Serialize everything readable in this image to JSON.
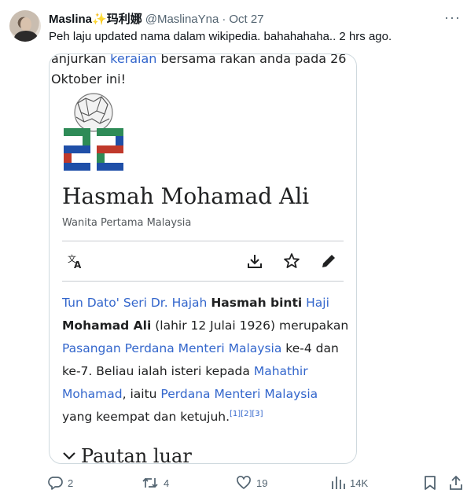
{
  "tweet": {
    "display_name": "Maslina",
    "name_emoji": "✨",
    "name_chinese": "玛利娜",
    "handle": "@MaslinaYna",
    "separator": "·",
    "date": "Oct 27",
    "more": "···",
    "text": "Peh laju updated nama dalam wikipedia. bahahahaha.. 2 hrs ago."
  },
  "wiki": {
    "top_line1_a": "anjurkan ",
    "top_line1_link": "keraian",
    "top_line1_b": " bersama rakan anda pada 26",
    "top_line2": "Oktober ini!",
    "logo_number": "22",
    "title": "Hasmah Mohamad Ali",
    "subtitle": "Wanita Pertama Malaysia",
    "body": {
      "l1_link1": "Tun Dato' Seri Dr. Hajah",
      "l1_bold": "Hasmah binti",
      "l1_link2": "Haji",
      "l2_bold": "Mohamad Ali",
      "l2_text": " (lahir 12 Julai 1926) merupakan",
      "l3_link": "Pasangan Perdana Menteri Malaysia",
      "l3_text": " ke-4 dan",
      "l4_text": "ke-7. Beliau ialah isteri kepada ",
      "l4_link": "Mahathir",
      "l5_link1": "Mohamad",
      "l5_text": ", iaitu ",
      "l5_link2": "Perdana Menteri Malaysia",
      "l6_text": "yang keempat dan ketujuh.",
      "l6_refs": "[1][2][3]"
    },
    "section": "Pautan luar"
  },
  "actions": {
    "replies": "2",
    "reposts": "4",
    "likes": "19",
    "views": "14K"
  },
  "colors": {
    "link": "#3366cc",
    "muted": "#536471",
    "wiki_text": "#202122",
    "logo_green": "#2e8b57",
    "logo_blue": "#1f4fa8",
    "logo_red": "#c0392b"
  }
}
